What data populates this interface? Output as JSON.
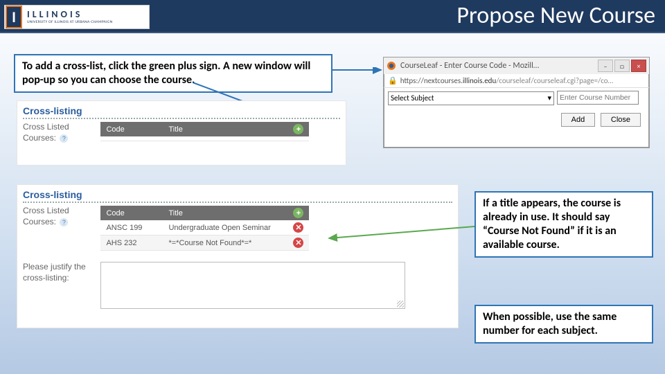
{
  "header": {
    "logo_letters": "ILLINOIS",
    "logo_sub": "UNIVERSITY OF ILLINOIS AT URBANA-CHAMPAIGN",
    "page_title": "Propose New Course"
  },
  "callouts": {
    "c1": "To add a cross-list, click the green plus sign. A new window will pop-up so you can choose the course.",
    "c2": "If a title appears, the course is already in use. It should say “Course Not Found” if it is an available course.",
    "c3": "When possible, use the same number for each subject."
  },
  "popup": {
    "title": "CourseLeaf - Enter Course Code - Mozill…",
    "url_host": "https://nextcourses.",
    "url_mid": "illinois.edu",
    "url_rest": "/courseleaf/courseleaf.cgi?page=/co…",
    "select_label": "Select Subject",
    "num_placeholder": "Enter Course Number",
    "btn_add": "Add",
    "btn_close": "Close"
  },
  "section": {
    "title": "Cross-listing",
    "label": "Cross Listed Courses:",
    "col_code": "Code",
    "col_title": "Title"
  },
  "table2": {
    "rows": [
      {
        "code": "ANSC 199",
        "title": "Undergraduate Open Seminar"
      },
      {
        "code": "AHS 232",
        "title": "*=*Course Not Found*=*"
      }
    ]
  },
  "justify": {
    "label": "Please justify the cross-listing:"
  }
}
